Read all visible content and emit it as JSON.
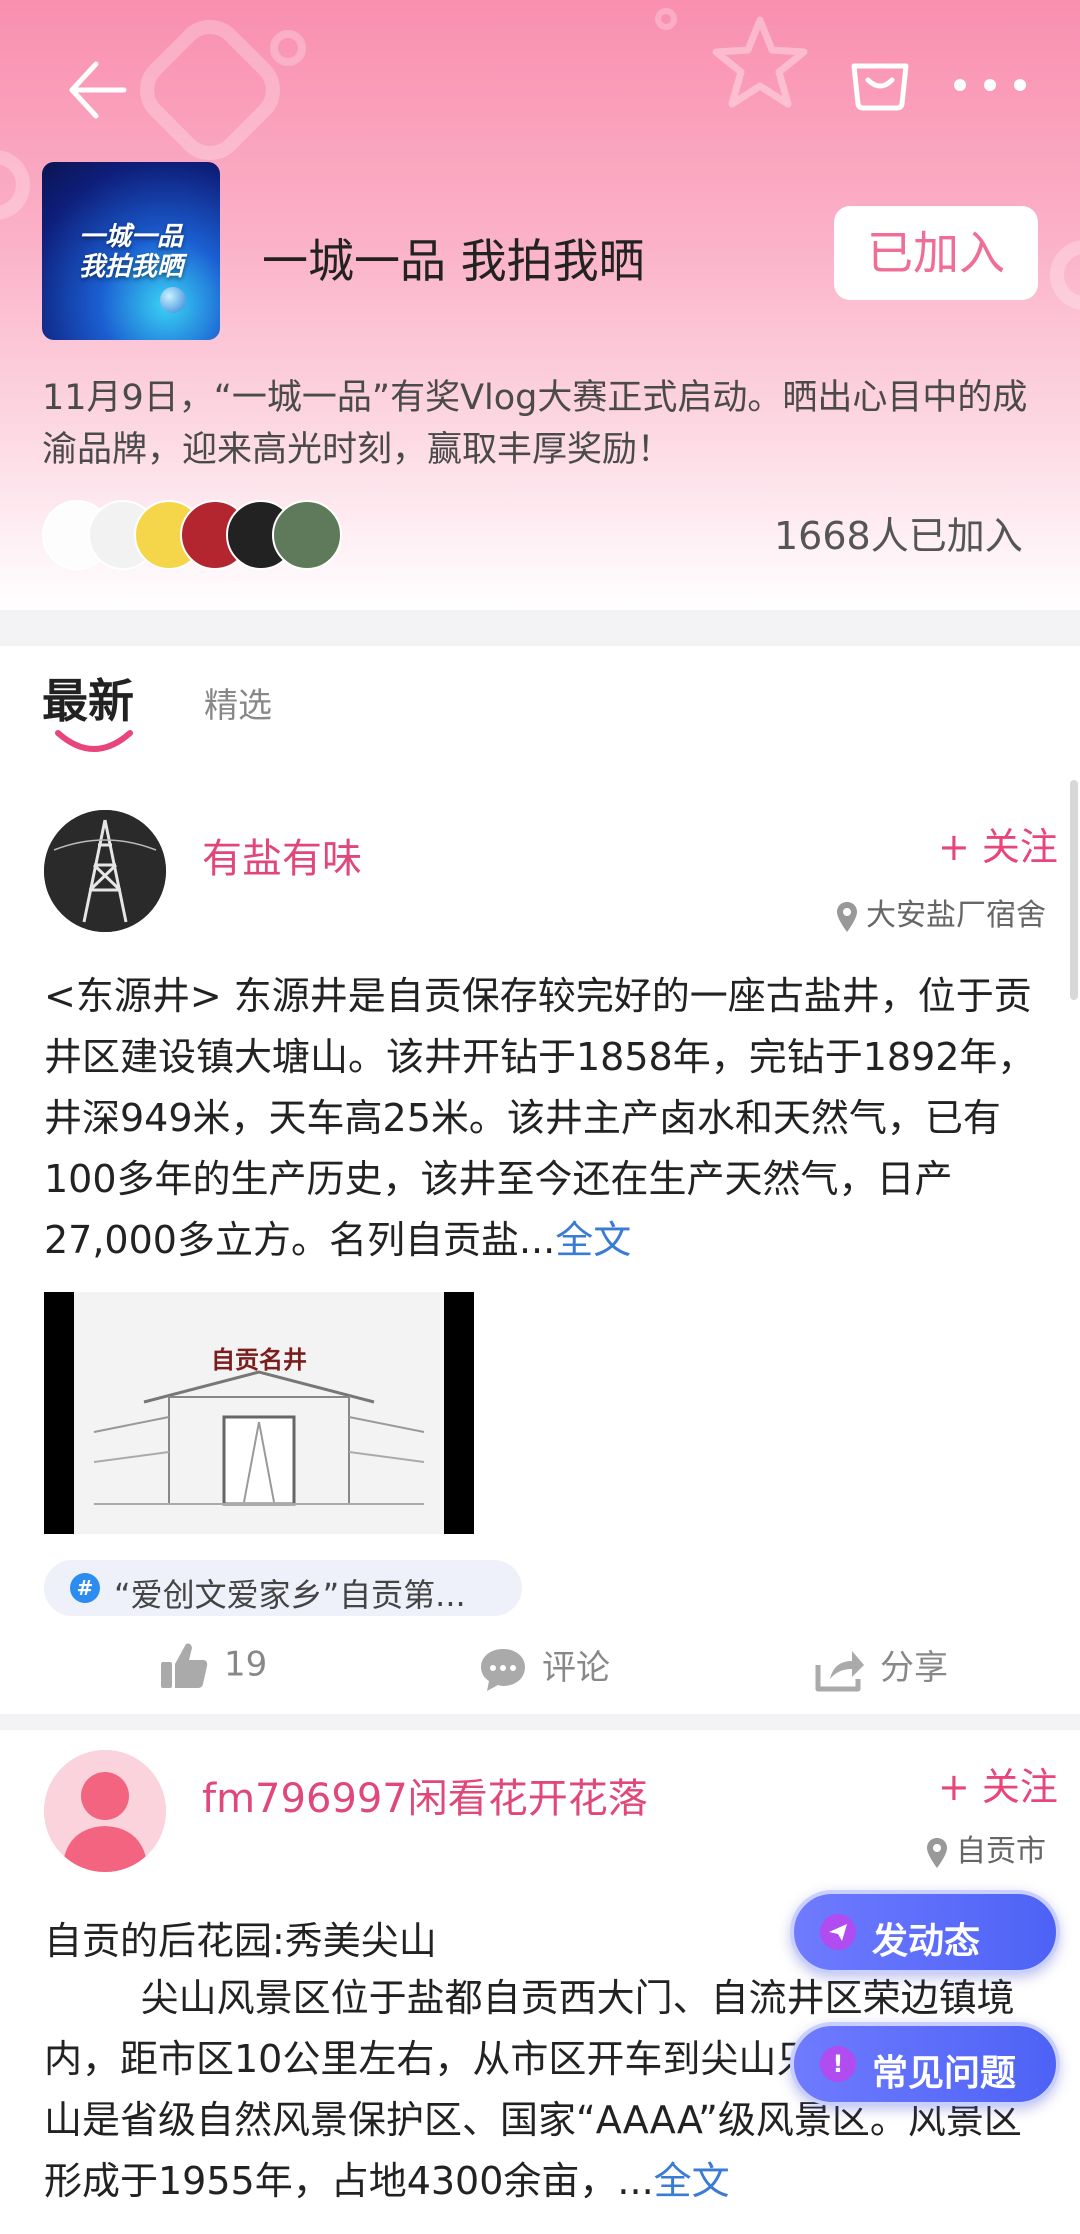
{
  "header": {
    "cover_text_line1": "一城一品",
    "cover_text_line2": "我拍我晒",
    "group_title": "一城一品 我拍我晒",
    "join_label": "已加入",
    "description": "11月9日，“一城一品”有奖Vlog大赛正式启动。晒出心目中的成渝品牌，迎来高光时刻，赢取丰厚奖励！",
    "member_count": "1668人已加入"
  },
  "tabs": {
    "latest": "最新",
    "featured": "精选"
  },
  "posts": [
    {
      "username": "有盐有味",
      "follow_label": "+ 关注",
      "location": "大安盐厂宿舍",
      "text": "<东源井>      东源井是自贡保存较完好的一座古盐井，位于贡井区建设镇大塘山。该井开钻于1858年，完钻于1892年，井深949米，天车高25米。该井主产卤水和天然气，已有100多年的生产历史，该井至今还在生产天然气，日产27,000多立方。名列自贡盐...",
      "more_label": "全文",
      "image_caption": "自贡名井",
      "topic": "“爱创文爱家乡”自贡第...",
      "likes": "19",
      "comment_label": "评论",
      "share_label": "分享"
    },
    {
      "username": "fm796997闲看花开花落",
      "follow_label": "+ 关注",
      "location": "自贡市",
      "title": "自贡的后花园:秀美尖山",
      "text": "        尖山风景区位于盐都自贡西大门、自流井区荣边镇境内，距市区10公里左右，从市区开车到尖山只需20分钟。尖山是省级自然风景保护区、国家“AAAA”级风景区。风景区形成于1955年，占地4300余亩，...",
      "more_label": "全文"
    }
  ],
  "floating": {
    "post_label": "发动态",
    "faq_label": "常见问题"
  },
  "colors": {
    "accent_pink": "#e8457a",
    "link_blue": "#3a7bd5",
    "float_blue": "#5667f7"
  }
}
